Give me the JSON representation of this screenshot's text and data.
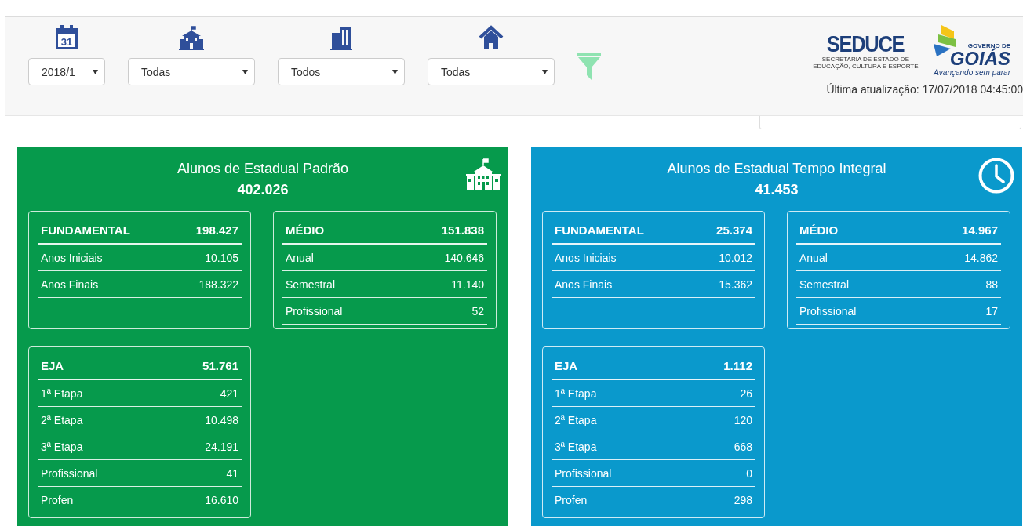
{
  "filters": [
    {
      "kind": "calendar",
      "value": "2018/1",
      "calendar_day": "31"
    },
    {
      "kind": "school",
      "value": "Todas"
    },
    {
      "kind": "building",
      "value": "Todos"
    },
    {
      "kind": "house",
      "value": "Todas"
    }
  ],
  "logos": {
    "seduce": {
      "name": "SEDUCE",
      "subtitle": "SECRETARIA DE ESTADO DE EDUCAÇÃO, CULTURA E ESPORTE"
    },
    "goias": {
      "caption": "GOVERNO DE",
      "name": "GOIÁS",
      "slogan": "Avançando sem parar"
    }
  },
  "last_update": "Última atualização: 17/07/2018 04:45:00",
  "panels": [
    {
      "title": "Alunos de Estadual Padrão",
      "total": "402.026",
      "kind": "school",
      "color": "#069a4c",
      "groups": [
        {
          "name": "FUNDAMENTAL",
          "total": "198.427",
          "rows": [
            {
              "label": "Anos Iniciais",
              "value": "10.105"
            },
            {
              "label": "Anos Finais",
              "value": "188.322"
            }
          ]
        },
        {
          "name": "MÉDIO",
          "total": "151.838",
          "rows": [
            {
              "label": "Anual",
              "value": "140.646"
            },
            {
              "label": "Semestral",
              "value": "11.140"
            },
            {
              "label": "Profissional",
              "value": "52"
            }
          ]
        },
        {
          "name": "EJA",
          "total": "51.761",
          "rows": [
            {
              "label": "1ª Etapa",
              "value": "421"
            },
            {
              "label": "2ª Etapa",
              "value": "10.498"
            },
            {
              "label": "3ª Etapa",
              "value": "24.191"
            },
            {
              "label": "Profissional",
              "value": "41"
            },
            {
              "label": "Profen",
              "value": "16.610"
            }
          ]
        }
      ]
    },
    {
      "title": "Alunos de Estadual Tempo Integral",
      "total": "41.453",
      "kind": "clock",
      "color": "#0a99cc",
      "groups": [
        {
          "name": "FUNDAMENTAL",
          "total": "25.374",
          "rows": [
            {
              "label": "Anos Iniciais",
              "value": "10.012"
            },
            {
              "label": "Anos Finais",
              "value": "15.362"
            }
          ]
        },
        {
          "name": "MÉDIO",
          "total": "14.967",
          "rows": [
            {
              "label": "Anual",
              "value": "14.862"
            },
            {
              "label": "Semestral",
              "value": "88"
            },
            {
              "label": "Profissional",
              "value": "17"
            }
          ]
        },
        {
          "name": "EJA",
          "total": "1.112",
          "rows": [
            {
              "label": "1ª Etapa",
              "value": "26"
            },
            {
              "label": "2ª Etapa",
              "value": "120"
            },
            {
              "label": "3ª Etapa",
              "value": "668"
            },
            {
              "label": "Profissional",
              "value": "0"
            },
            {
              "label": "Profen",
              "value": "298"
            }
          ]
        }
      ]
    }
  ]
}
